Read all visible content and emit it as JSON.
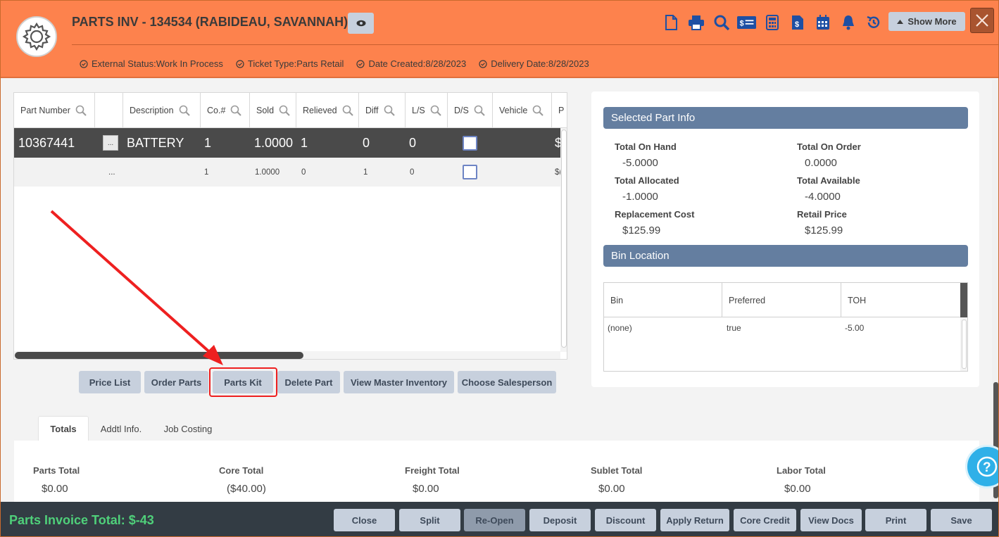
{
  "header": {
    "title": "PARTS INV - 134534 (RABIDEAU, SAVANNAH)",
    "show_more_label": "Show More",
    "status": [
      {
        "label": "External Status:Work In Process"
      },
      {
        "label": "Ticket Type:Parts Retail"
      },
      {
        "label": "Date Created:8/28/2023"
      },
      {
        "label": "Delivery Date:8/28/2023"
      }
    ],
    "toolbar_icons": [
      "document-icon",
      "print-icon",
      "search-icon",
      "check-icon",
      "calculator-icon",
      "invoice-icon",
      "calendar-icon",
      "bell-icon",
      "history-icon"
    ]
  },
  "grid": {
    "columns": [
      "Part Number",
      "",
      "Description",
      "Co.#",
      "Sold",
      "Relieved",
      "Diff",
      "L/S",
      "D/S",
      "Vehicle",
      "P"
    ],
    "rows": [
      {
        "part_number": "10367441",
        "dots": "...",
        "description": "BATTERY",
        "co": "1",
        "sold": "1.0000",
        "relieved": "1",
        "diff": "0",
        "ls": "0",
        "price": "$"
      },
      {
        "part_number": "",
        "dots": "...",
        "description": "",
        "co": "1",
        "sold": "1.0000",
        "relieved": "0",
        "diff": "1",
        "ls": "0",
        "price": "$("
      }
    ]
  },
  "actions": {
    "price_list": "Price List",
    "order_parts": "Order Parts",
    "parts_kit": "Parts Kit",
    "delete_part": "Delete Part",
    "view_master_inventory": "View Master Inventory",
    "choose_salesperson": "Choose Salesperson"
  },
  "selected_part": {
    "heading": "Selected Part Info",
    "total_on_hand_label": "Total On Hand",
    "total_on_hand": "-5.0000",
    "total_on_order_label": "Total On Order",
    "total_on_order": "0.0000",
    "total_allocated_label": "Total Allocated",
    "total_allocated": "-1.0000",
    "total_available_label": "Total Available",
    "total_available": "-4.0000",
    "replacement_cost_label": "Replacement Cost",
    "replacement_cost": "$125.99",
    "retail_price_label": "Retail Price",
    "retail_price": "$125.99"
  },
  "bin_location": {
    "heading": "Bin Location",
    "columns": [
      "Bin",
      "Preferred",
      "TOH"
    ],
    "rows": [
      {
        "bin": "(none)",
        "preferred": "true",
        "toh": "-5.00"
      }
    ]
  },
  "tabs": [
    "Totals",
    "Addtl Info.",
    "Job Costing"
  ],
  "totals": {
    "parts_total_label": "Parts Total",
    "parts_total": "$0.00",
    "core_total_label": "Core Total",
    "core_total": "($40.00)",
    "freight_total_label": "Freight Total",
    "freight_total": "$0.00",
    "sublet_total_label": "Sublet Total",
    "sublet_total": "$0.00",
    "labor_total_label": "Labor Total",
    "labor_total": "$0.00"
  },
  "footer": {
    "invoice_total": "Parts Invoice Total: $-43",
    "buttons": [
      "Close",
      "Split",
      "Re-Open",
      "Deposit",
      "Discount",
      "Apply Return",
      "Core Credit",
      "View Docs",
      "Print",
      "Save"
    ]
  },
  "colors": {
    "header_bg": "#fd824d",
    "section_head": "#647ea0",
    "footer_bg": "#333c44",
    "total_green": "#4fd07a",
    "annotation_red": "#ee2020"
  }
}
